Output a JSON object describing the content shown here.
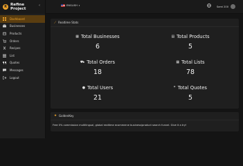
{
  "brand": {
    "line1": "Refine",
    "line2": "Project",
    "logo_letter": "R"
  },
  "header": {
    "language": "ENGLISH",
    "user_name": "Sami 200",
    "globe_icon": "globe-icon"
  },
  "sidebar": {
    "items": [
      {
        "label": "Dashboard",
        "icon": "dashboard-icon",
        "active": true
      },
      {
        "label": "Businesses",
        "icon": "briefcase-icon"
      },
      {
        "label": "Products",
        "icon": "box-icon"
      },
      {
        "label": "Orders",
        "icon": "cart-icon"
      },
      {
        "label": "Recipes",
        "icon": "utensils-icon"
      },
      {
        "label": "List",
        "icon": "list-icon"
      },
      {
        "label": "Quotes",
        "icon": "quote-icon"
      },
      {
        "label": "Messages",
        "icon": "messages-icon"
      },
      {
        "label": "Logout",
        "icon": "logout-icon"
      }
    ]
  },
  "stats_panel": {
    "title": "Realtime Stats",
    "stats": [
      {
        "label": "Total Businesses",
        "value": "6",
        "icon": "building-icon"
      },
      {
        "label": "Total Products",
        "value": "5",
        "icon": "products-icon"
      },
      {
        "label": "Total Orders",
        "value": "18",
        "icon": "cart-icon"
      },
      {
        "label": "Total Lists",
        "value": "78",
        "icon": "table-icon"
      },
      {
        "label": "Total Users",
        "value": "21",
        "icon": "user-icon"
      },
      {
        "label": "Total Quotes",
        "value": "5",
        "icon": "quote-icon"
      }
    ]
  },
  "golden_panel": {
    "title": "GoldenKey",
    "text": "Free 0% commission multilingual, global realtime ecommerce business/product search funnel. Give it a try!"
  },
  "colors": {
    "accent": "#f0a42a",
    "active_bg": "#5a3d10",
    "panel_bg": "#1f1f1f",
    "page_bg": "#141414"
  }
}
